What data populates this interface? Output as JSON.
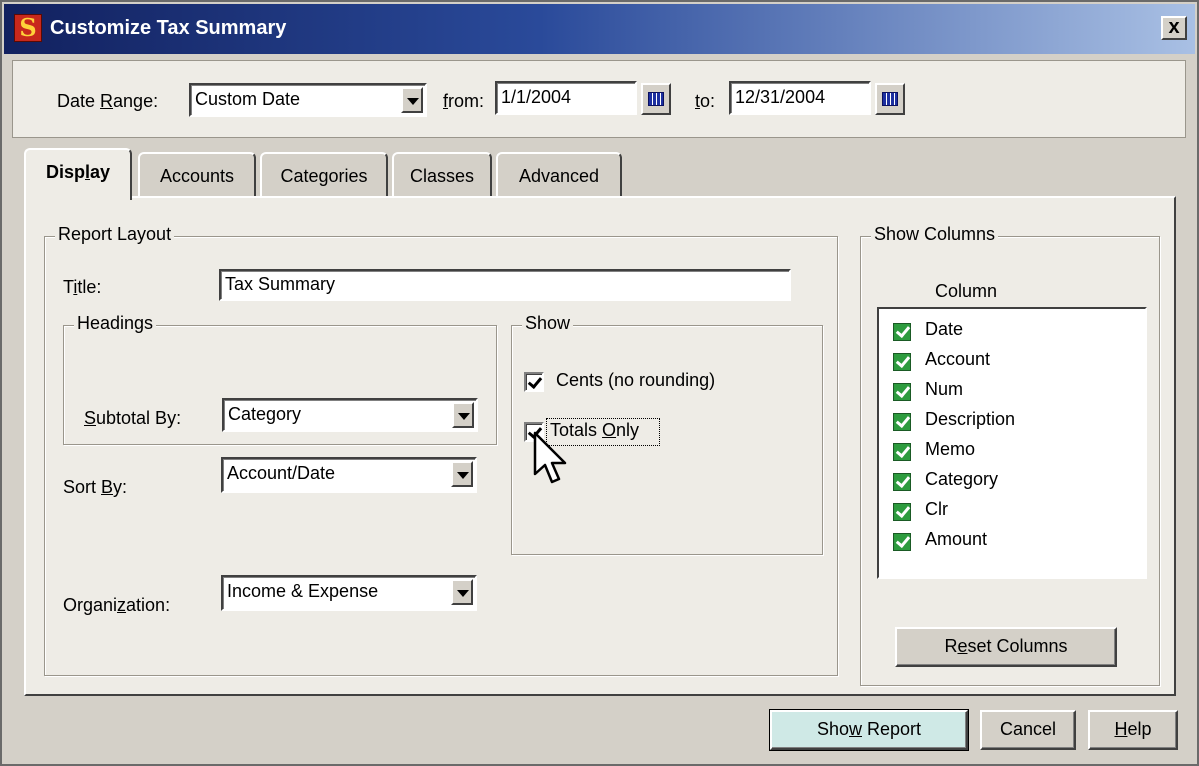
{
  "window": {
    "title": "Customize Tax Summary",
    "app_icon_letter": "S",
    "close_glyph": "x"
  },
  "date_range": {
    "label_prefix": "Date ",
    "label_accel": "R",
    "label_suffix": "ange:",
    "value": "Custom Date",
    "from_accel": "f",
    "from_suffix": "rom:",
    "from_value": "1/1/2004",
    "to_accel": "t",
    "to_suffix": "o:",
    "to_value": "12/31/2004"
  },
  "tabs": [
    {
      "label_prefix": "Disp",
      "accel": "l",
      "label_suffix": "ay",
      "active": true
    },
    {
      "label": "Accounts"
    },
    {
      "label": "Categories"
    },
    {
      "label": "Classes"
    },
    {
      "label": "Advanced"
    }
  ],
  "report_layout": {
    "group_title": "Report Layout",
    "title_label_prefix": "T",
    "title_accel": "i",
    "title_label_suffix": "tle:",
    "title_value": "Tax Summary",
    "headings_title": "Headings",
    "subtotal_accel": "S",
    "subtotal_label_suffix": "ubtotal By:",
    "subtotal_value": "Category",
    "sort_label_prefix": "Sort ",
    "sort_accel": "B",
    "sort_label_suffix": "y:",
    "sort_value": "Account/Date",
    "org_label_prefix": "Organi",
    "org_accel": "z",
    "org_label_suffix": "ation:",
    "org_value": "Income & Expense"
  },
  "show": {
    "title": "Show",
    "cents_label": "Cents (no rounding)",
    "cents_checked": true,
    "totals_label_prefix": "Totals ",
    "totals_accel": "O",
    "totals_label_suffix": "nly",
    "totals_checked": true
  },
  "show_columns": {
    "title": "Show Columns",
    "header": "Column",
    "columns": [
      "Date",
      "Account",
      "Num",
      "Description",
      "Memo",
      "Category",
      "Clr",
      "Amount"
    ],
    "reset_prefix": "R",
    "reset_accel": "e",
    "reset_suffix": "set Columns"
  },
  "buttons": {
    "show_report_prefix": "Sho",
    "show_report_accel": "w",
    "show_report_suffix": " Report",
    "cancel": "Cancel",
    "help_accel": "H",
    "help_suffix": "elp"
  },
  "colors": {
    "dialog_bg": "#d4d0c8",
    "panel_bg": "#eeece6",
    "title_gradient_start": "#12215f",
    "column_check_green": "#2d9b3e"
  },
  "icons": [
    "app-logo-icon",
    "close-icon",
    "calendar-icon",
    "dropdown-arrow-icon",
    "checkmark-icon",
    "mouse-pointer-icon"
  ]
}
